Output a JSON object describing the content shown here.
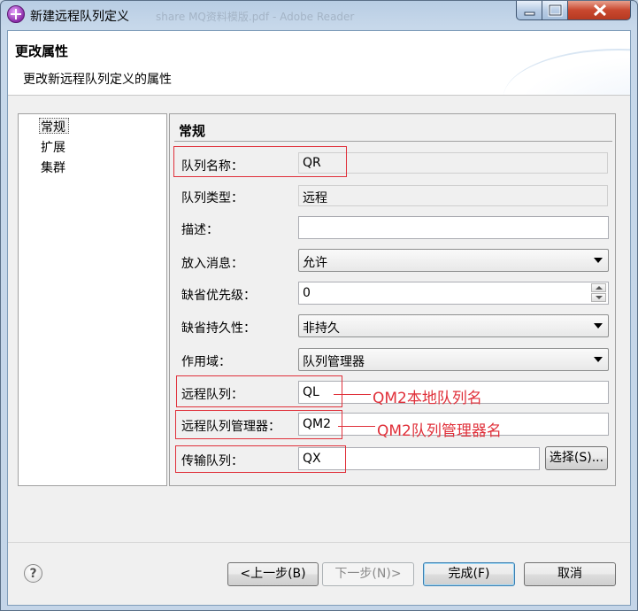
{
  "window": {
    "title": "新建远程队列定义",
    "title_ghost": "share MQ资料模版.pdf - Adobe Reader"
  },
  "header": {
    "title": "更改属性",
    "subtitle": "更改新远程队列定义的属性"
  },
  "nav": {
    "items": [
      {
        "label": "常规",
        "selected": true
      },
      {
        "label": "扩展",
        "selected": false
      },
      {
        "label": "集群",
        "selected": false
      }
    ]
  },
  "panel": {
    "title": "常规",
    "fields": {
      "queue_name": {
        "label": "队列名称：",
        "value": "QR"
      },
      "queue_type": {
        "label": "队列类型：",
        "value": "远程"
      },
      "description": {
        "label": "描述：",
        "value": ""
      },
      "put_messages": {
        "label": "放入消息：",
        "value": "允许"
      },
      "default_priority": {
        "label": "缺省优先级：",
        "value": "0"
      },
      "default_persistence": {
        "label": "缺省持久性：",
        "value": "非持久"
      },
      "scope": {
        "label": "作用域：",
        "value": "队列管理器"
      },
      "remote_queue": {
        "label": "远程队列：",
        "value": "QL"
      },
      "remote_qmgr": {
        "label": "远程队列管理器：",
        "value": "QM2"
      },
      "xmit_queue": {
        "label": "传输队列：",
        "value": "QX"
      }
    },
    "select_button": "选择(S)..."
  },
  "annotations": {
    "remote_queue_note": "QM2本地队列名",
    "remote_qmgr_note": "QM2队列管理器名",
    "color": "#e0303a"
  },
  "footer": {
    "help_icon": "?",
    "back": "<上一步(B)",
    "next": "下一步(N)>",
    "finish": "完成(F)",
    "cancel": "取消"
  }
}
